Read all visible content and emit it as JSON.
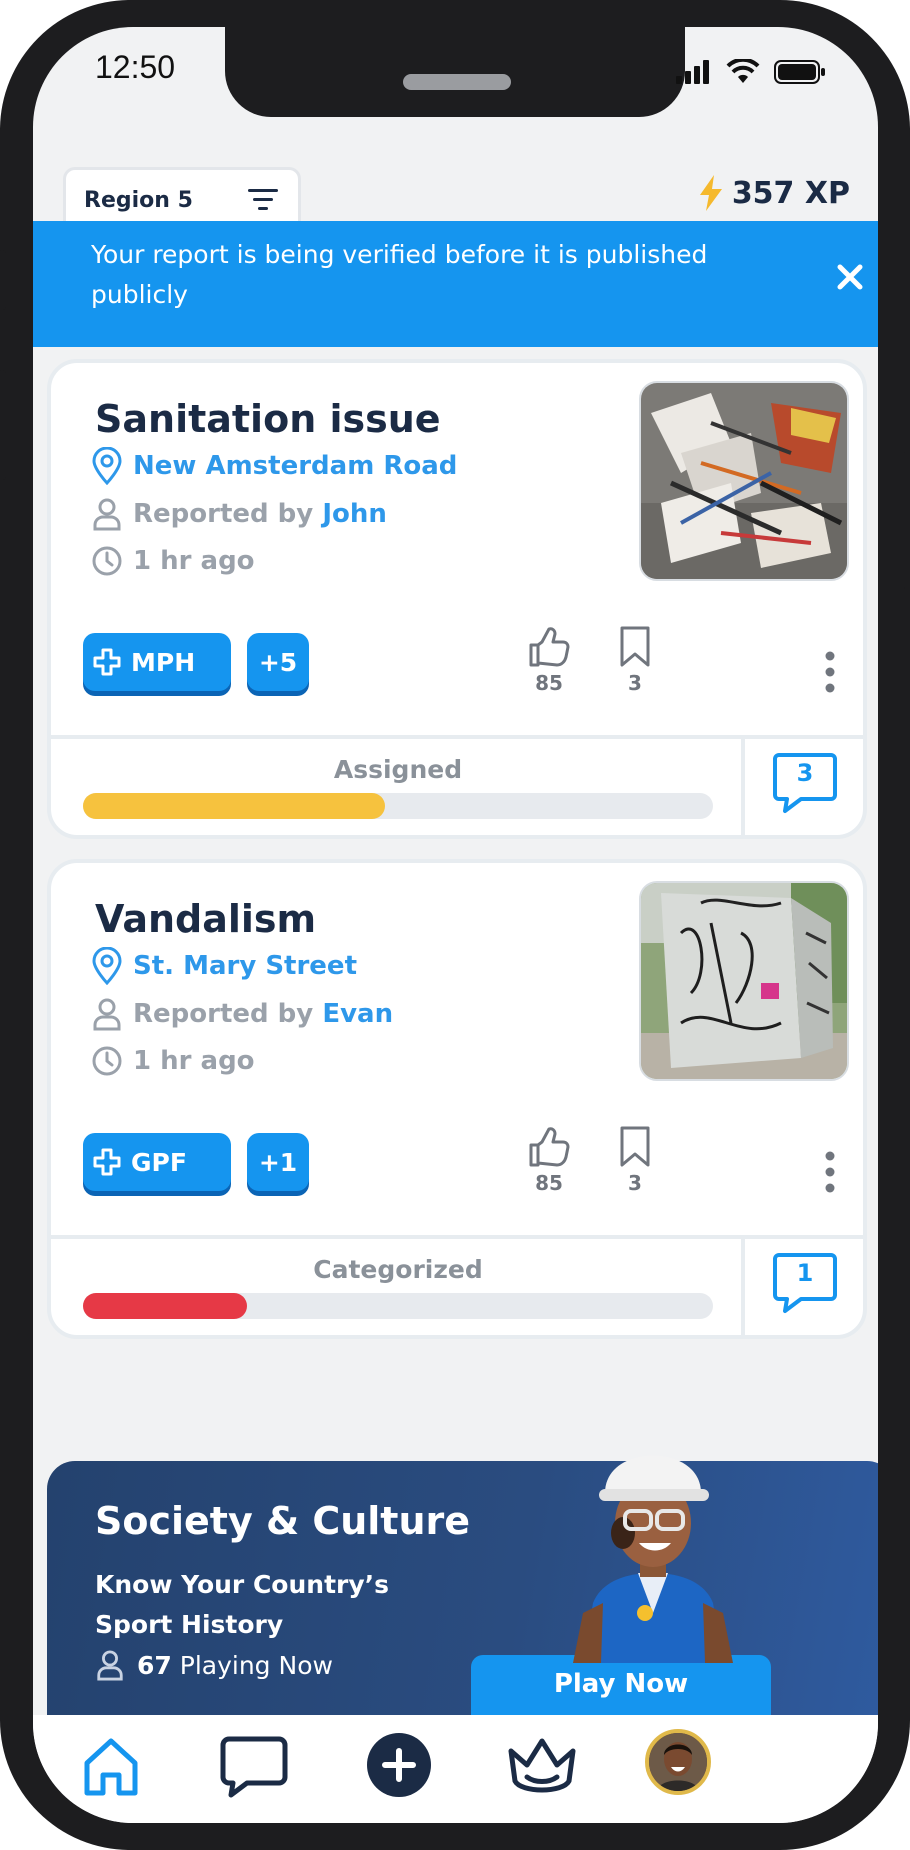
{
  "status_bar": {
    "time": "12:50"
  },
  "header": {
    "region_label": "Region 5",
    "xp_label": "357 XP"
  },
  "banner": {
    "message": "Your report is being verified before it is published publicly"
  },
  "reports": [
    {
      "title": "Sanitation issue",
      "location": "New Amsterdam Road",
      "reported_by_prefix": "Reported by",
      "reporter": "John",
      "time_ago": "1 hr ago",
      "tag": "MPH",
      "tag_more": "+5",
      "likes": "85",
      "bookmarks": "3",
      "status": "Assigned",
      "progress": 0.48,
      "progress_color": "#f6c23e",
      "comments": "3"
    },
    {
      "title": "Vandalism",
      "location": "St. Mary Street",
      "reported_by_prefix": "Reported by",
      "reporter": "Evan",
      "time_ago": "1 hr ago",
      "tag": "GPF",
      "tag_more": "+1",
      "likes": "85",
      "bookmarks": "3",
      "status": "Categorized",
      "progress": 0.26,
      "progress_color": "#e63946",
      "comments": "1"
    }
  ],
  "promo": {
    "title": "Society & Culture",
    "subtitle": "Know Your Country’s Sport History",
    "players_count": "67",
    "players_label": "Playing Now",
    "play_button": "Play Now"
  },
  "colors": {
    "accent": "#1595ef",
    "navy": "#1b2b45",
    "banner": "#1595ef"
  },
  "bottom_nav": [
    "home-icon",
    "chat-icon",
    "add-icon",
    "crown-icon",
    "avatar"
  ]
}
